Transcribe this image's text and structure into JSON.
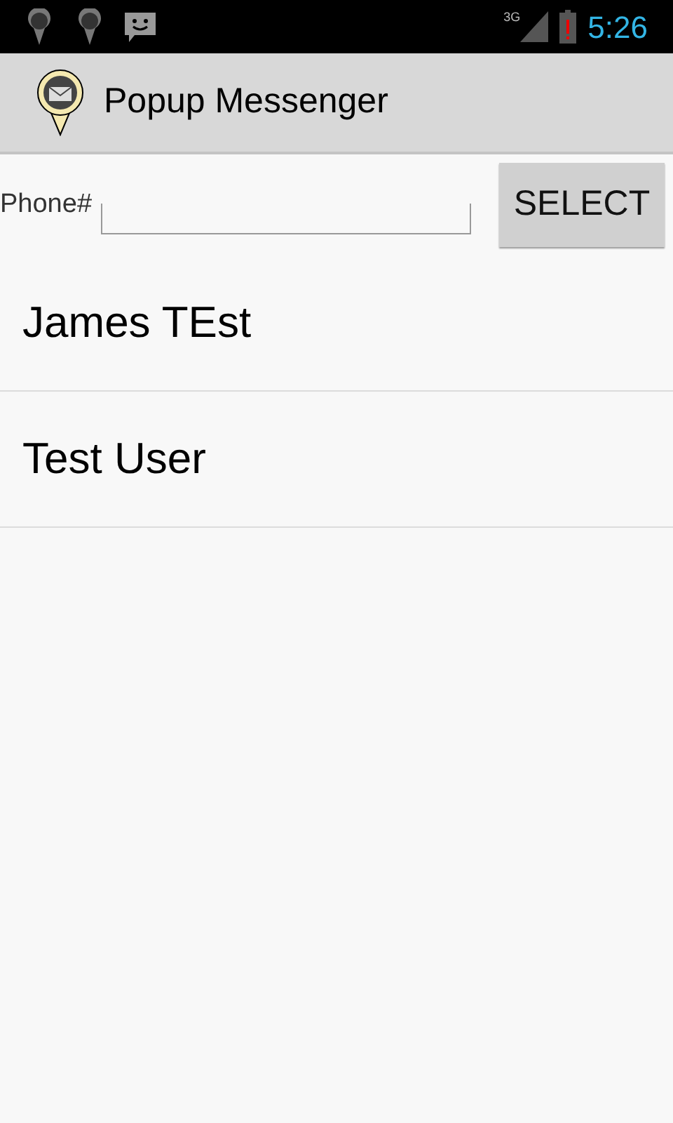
{
  "status_bar": {
    "network": "3G",
    "time": "5:26"
  },
  "action_bar": {
    "title": "Popup Messenger"
  },
  "phone_form": {
    "label": "Phone#",
    "button": "SELECT"
  },
  "contacts": [
    {
      "name": "James TEst"
    },
    {
      "name": "Test User"
    }
  ]
}
